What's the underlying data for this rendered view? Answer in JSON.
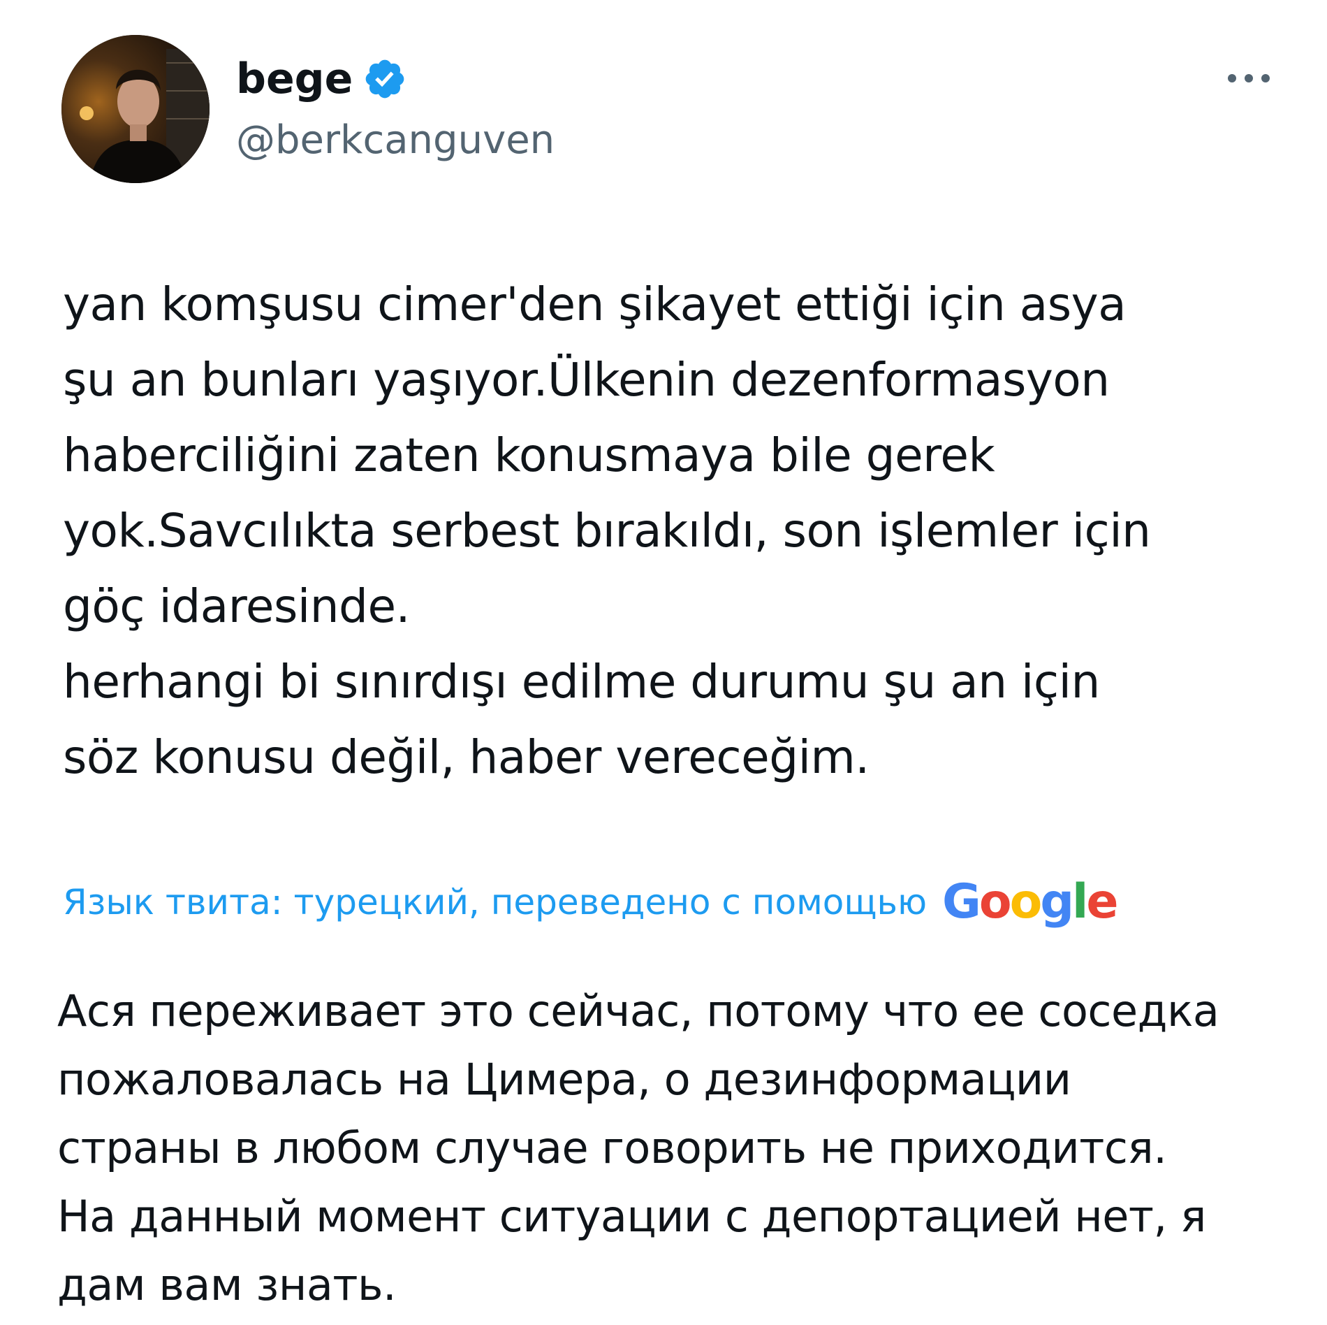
{
  "author": {
    "display_name": "bege",
    "handle": "@berkcanguven",
    "verified": true,
    "avatar_icon": "profile-photo"
  },
  "actions": {
    "more_icon": "ellipsis-horizontal-icon"
  },
  "tweet": {
    "text": "yan komşusu cimer'den şikayet ettiği için asya\nşu an bunları yaşıyor.Ülkenin dezenformasyon\nhaberciliğini zaten konusmaya bile gerek\nyok.Savcılıkta serbest bırakıldı, son işlemler için\ngöç idaresinde.\nherhangi bi sınırdışı edilme durumu şu an için\nsöz konusu değil, haber vereceğim."
  },
  "translation": {
    "label": "Язык твита: турецкий, переведено с помощью",
    "provider": "Google",
    "text": "Ася переживает это сейчас, потому что ее соседка\nпожаловалась на Цимера, о дезинформации\nстраны в любом случае говорить не приходится.\nНа данный момент ситуации с депортацией нет, я\nдам вам знать."
  },
  "colors": {
    "verified_badge": "#1d9bf0",
    "link": "#1d9bf0",
    "secondary_text": "#536471",
    "primary_text": "#0f1419"
  }
}
